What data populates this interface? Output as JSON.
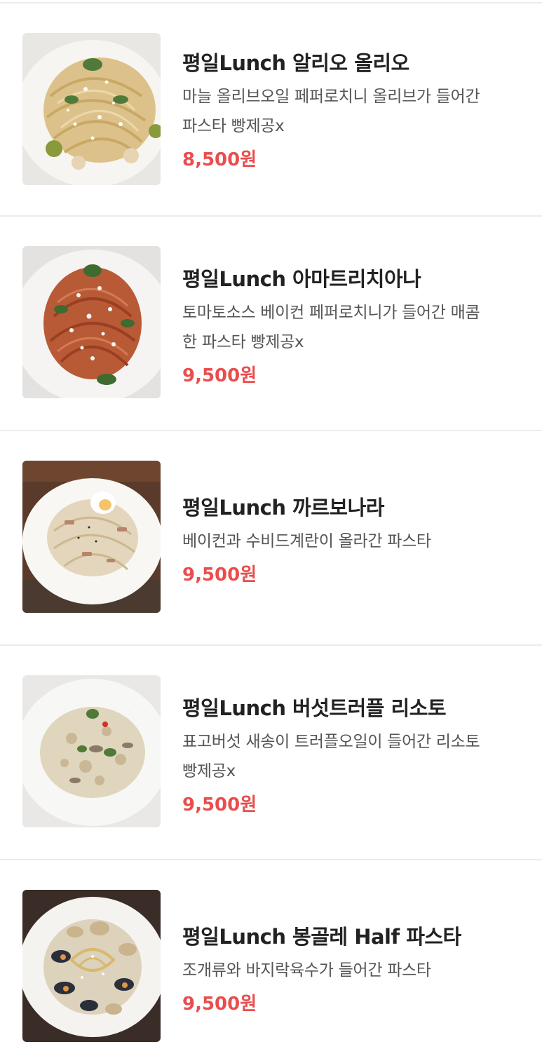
{
  "menu": {
    "items": [
      {
        "name": "평일Lunch 알리오 올리오",
        "desc_lines": [
          "마늘 올리브오일 페퍼로치니 올리브가 들어간",
          "파스타 빵제공x"
        ],
        "price": "8,500원"
      },
      {
        "name": "평일Lunch 아마트리치아나",
        "desc_lines": [
          "토마토소스 베이컨 페퍼로치니가 들어간 매콤",
          "한 파스타 빵제공x"
        ],
        "price": "9,500원"
      },
      {
        "name": "평일Lunch 까르보나라",
        "desc_lines": [
          "베이컨과 수비드계란이 올라간 파스타"
        ],
        "price": "9,500원"
      },
      {
        "name": "평일Lunch 버섯트러플 리소토",
        "desc_lines": [
          "표고버섯 새송이 트러플오일이 들어간 리소토",
          "빵제공x"
        ],
        "price": "9,500원"
      },
      {
        "name": "평일Lunch 봉골레 Half 파스타",
        "desc_lines": [
          "조개류와 바지락육수가 들어간 파스타"
        ],
        "price": "9,500원"
      }
    ]
  },
  "colors": {
    "price": "#ea4d4d",
    "title": "#222222",
    "desc": "#555555",
    "divider": "#ececec"
  }
}
